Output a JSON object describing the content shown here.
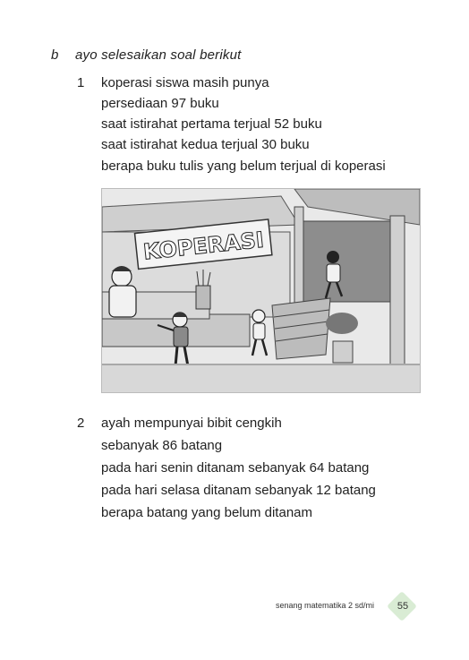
{
  "section": {
    "letter": "b",
    "title": "ayo selesaikan soal berikut"
  },
  "problems": [
    {
      "number": "1",
      "lines": [
        "koperasi siswa masih punya",
        "persediaan 97 buku",
        "saat istirahat pertama terjual 52 buku",
        "saat istirahat kedua terjual 30 buku",
        "berapa buku tulis yang belum terjual di koperasi"
      ]
    },
    {
      "number": "2",
      "lines": [
        "ayah mempunyai bibit cengkih",
        "sebanyak 86 batang",
        "pada hari senin ditanam sebanyak 64 batang",
        "pada hari selasa  ditanam sebanyak 12 batang",
        "berapa batang yang belum ditanam"
      ]
    }
  ],
  "illustration": {
    "banner_text": "KOPERASI"
  },
  "footer": {
    "text": "senang matematika 2 sd/mi",
    "page_number": "55",
    "badge_color": "#d9ecd4"
  }
}
